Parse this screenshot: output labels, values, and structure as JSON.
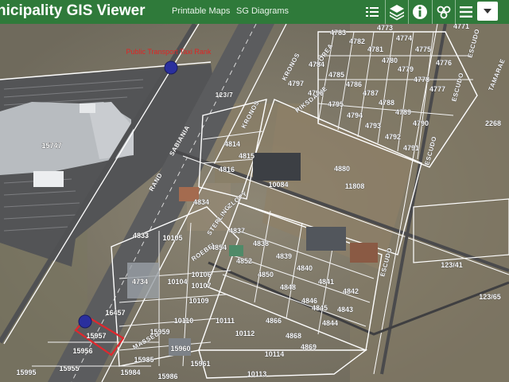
{
  "header": {
    "title": "nicipality GIS Viewer",
    "links": [
      "Printable Maps",
      "SG Diagrams"
    ]
  },
  "toolbar": {
    "icons": [
      "layer-list-icon",
      "layers-icon",
      "info-icon",
      "basemap-gallery-icon",
      "menu-icon",
      "dropdown-caret-icon"
    ]
  },
  "map": {
    "annotation": "Public Transport Taxi Rank",
    "roads": {
      "n2_a": "123/7",
      "sabiania": "SABIANIA",
      "kronos": "KRONOS",
      "kronos2": "KRONOS",
      "korea": "KOREA",
      "riksdakie": "RIKSDAKIE",
      "escudo_a": "ESCUDO",
      "escudo_b": "ESCUDO",
      "escudo_c": "ESCUDO",
      "escudo_d": "ESCUDO",
      "sterling": "STERLING",
      "zloty": "ZLOTY",
      "rouble": "ROEBEL",
      "rand": "RAND",
      "masseu": "MASSEU",
      "tomosa": "TAMARAE"
    },
    "parcels": [
      "4783",
      "4773",
      "4774",
      "4771",
      "4782",
      "4781",
      "4775",
      "4780",
      "4776",
      "4784",
      "4779",
      "4785",
      "4778",
      "4797",
      "4786",
      "4777",
      "4796",
      "4787",
      "4795",
      "4788",
      "4789",
      "4794",
      "4790",
      "4793",
      "4792",
      "4791",
      "2268",
      "15747",
      "4814",
      "4815",
      "4816",
      "4880",
      "10084",
      "11808",
      "4834",
      "4833",
      "10105",
      "4837",
      "4838",
      "4854",
      "4839",
      "4852",
      "4840",
      "4850",
      "4848",
      "4841",
      "4842",
      "4846",
      "4845",
      "4843",
      "4844",
      "123/41",
      "123/65",
      "4734",
      "10104",
      "10106",
      "10107",
      "10109",
      "16457",
      "10110",
      "10111",
      "4866",
      "10112",
      "4868",
      "4869",
      "10114",
      "15957",
      "15959",
      "15960",
      "15961",
      "15956",
      "15985",
      "15955",
      "15995",
      "15984",
      "15986",
      "10113"
    ],
    "marker_colors": [
      "#2a2f9e"
    ],
    "highlight_color": "#e0282e"
  }
}
